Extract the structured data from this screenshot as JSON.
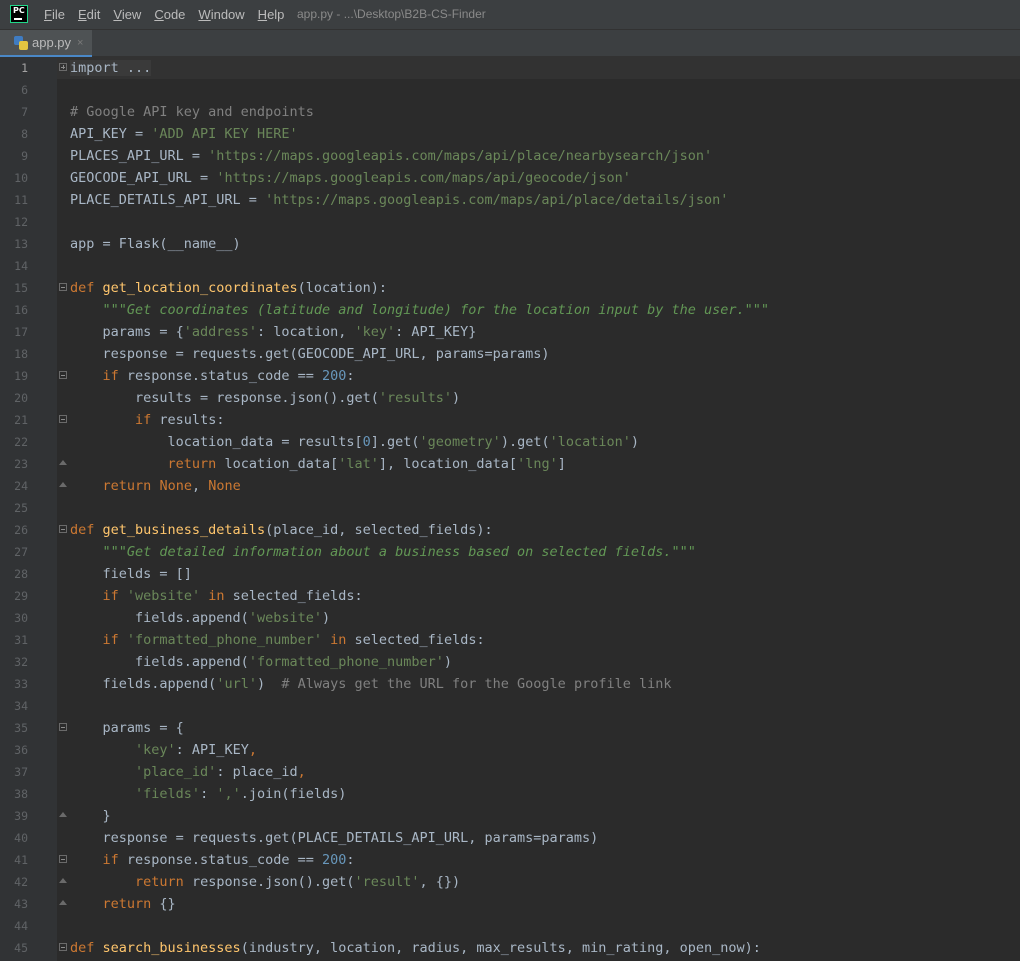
{
  "app": {
    "logo_text": "PC",
    "window_title": "app.py - ...\\Desktop\\B2B-CS-Finder"
  },
  "menu": [
    {
      "mnemonic": "F",
      "rest": "ile"
    },
    {
      "mnemonic": "E",
      "rest": "dit"
    },
    {
      "mnemonic": "V",
      "rest": "iew"
    },
    {
      "mnemonic": "C",
      "rest": "ode"
    },
    {
      "mnemonic": "W",
      "rest": "indow"
    },
    {
      "mnemonic": "H",
      "rest": "elp"
    }
  ],
  "tab": {
    "label": "app.py",
    "close_glyph": "×"
  },
  "editor": {
    "lines": [
      {
        "n": "1",
        "fold": "plus",
        "current": true,
        "tokens": [
          {
            "t": "import ...",
            "c": "folded-text"
          }
        ]
      },
      {
        "n": "6",
        "tokens": []
      },
      {
        "n": "7",
        "tokens": [
          {
            "t": "# Google API key and endpoints",
            "c": "cmt"
          }
        ]
      },
      {
        "n": "8",
        "tokens": [
          {
            "t": "API_KEY = "
          },
          {
            "t": "'ADD API KEY HERE'",
            "c": "str"
          }
        ]
      },
      {
        "n": "9",
        "tokens": [
          {
            "t": "PLACES_API_URL = "
          },
          {
            "t": "'https://maps.googleapis.com/maps/api/place/nearbysearch/json'",
            "c": "str"
          }
        ]
      },
      {
        "n": "10",
        "tokens": [
          {
            "t": "GEOCODE_API_URL = "
          },
          {
            "t": "'https://maps.googleapis.com/maps/api/geocode/json'",
            "c": "str"
          }
        ]
      },
      {
        "n": "11",
        "tokens": [
          {
            "t": "PLACE_DETAILS_API_URL = "
          },
          {
            "t": "'https://maps.googleapis.com/maps/api/place/details/json'",
            "c": "str"
          }
        ]
      },
      {
        "n": "12",
        "tokens": []
      },
      {
        "n": "13",
        "tokens": [
          {
            "t": "app = Flask(__name__)"
          }
        ]
      },
      {
        "n": "14",
        "tokens": []
      },
      {
        "n": "15",
        "fold": "minus",
        "tokens": [
          {
            "t": "def ",
            "c": "kw"
          },
          {
            "t": "get_location_coordinates",
            "c": "fn"
          },
          {
            "t": "(location):"
          }
        ]
      },
      {
        "n": "16",
        "tokens": [
          {
            "t": "    "
          },
          {
            "t": "\"\"\"Get coordinates (latitude and longitude) for the location input by the user.\"\"\"",
            "c": "doc"
          }
        ]
      },
      {
        "n": "17",
        "tokens": [
          {
            "t": "    params = {"
          },
          {
            "t": "'address'",
            "c": "str"
          },
          {
            "t": ": location, "
          },
          {
            "t": "'key'",
            "c": "str"
          },
          {
            "t": ": API_KEY}"
          }
        ]
      },
      {
        "n": "18",
        "tokens": [
          {
            "t": "    response = requests.get(GEOCODE_API_URL, params=params)"
          }
        ]
      },
      {
        "n": "19",
        "fold": "minus",
        "tokens": [
          {
            "t": "    "
          },
          {
            "t": "if",
            "c": "kw"
          },
          {
            "t": " response.status_code == "
          },
          {
            "t": "200",
            "c": "num"
          },
          {
            "t": ":"
          }
        ]
      },
      {
        "n": "20",
        "tokens": [
          {
            "t": "        results = response.json().get("
          },
          {
            "t": "'results'",
            "c": "str"
          },
          {
            "t": ")"
          }
        ]
      },
      {
        "n": "21",
        "fold": "minus",
        "tokens": [
          {
            "t": "        "
          },
          {
            "t": "if",
            "c": "kw"
          },
          {
            "t": " results:"
          }
        ]
      },
      {
        "n": "22",
        "tokens": [
          {
            "t": "            location_data = results["
          },
          {
            "t": "0",
            "c": "num"
          },
          {
            "t": "].get("
          },
          {
            "t": "'geometry'",
            "c": "str"
          },
          {
            "t": ").get("
          },
          {
            "t": "'location'",
            "c": "str"
          },
          {
            "t": ")"
          }
        ]
      },
      {
        "n": "23",
        "fold": "end",
        "tokens": [
          {
            "t": "            "
          },
          {
            "t": "return",
            "c": "kw"
          },
          {
            "t": " location_data["
          },
          {
            "t": "'lat'",
            "c": "str"
          },
          {
            "t": "], location_data["
          },
          {
            "t": "'lng'",
            "c": "str"
          },
          {
            "t": "]"
          }
        ]
      },
      {
        "n": "24",
        "fold": "end",
        "tokens": [
          {
            "t": "    "
          },
          {
            "t": "return",
            "c": "kw"
          },
          {
            "t": " "
          },
          {
            "t": "None",
            "c": "kw"
          },
          {
            "t": ", "
          },
          {
            "t": "None",
            "c": "kw"
          }
        ]
      },
      {
        "n": "25",
        "tokens": []
      },
      {
        "n": "26",
        "fold": "minus",
        "tokens": [
          {
            "t": "def ",
            "c": "kw"
          },
          {
            "t": "get_business_details",
            "c": "fn"
          },
          {
            "t": "(place_id, selected_fields):"
          }
        ]
      },
      {
        "n": "27",
        "tokens": [
          {
            "t": "    "
          },
          {
            "t": "\"\"\"Get detailed information about a business based on selected fields.\"\"\"",
            "c": "doc"
          }
        ]
      },
      {
        "n": "28",
        "tokens": [
          {
            "t": "    fields = []"
          }
        ]
      },
      {
        "n": "29",
        "tokens": [
          {
            "t": "    "
          },
          {
            "t": "if",
            "c": "kw"
          },
          {
            "t": " "
          },
          {
            "t": "'website'",
            "c": "str"
          },
          {
            "t": " "
          },
          {
            "t": "in",
            "c": "kw"
          },
          {
            "t": " selected_fields:"
          }
        ]
      },
      {
        "n": "30",
        "tokens": [
          {
            "t": "        fields.append("
          },
          {
            "t": "'website'",
            "c": "str"
          },
          {
            "t": ")"
          }
        ]
      },
      {
        "n": "31",
        "tokens": [
          {
            "t": "    "
          },
          {
            "t": "if",
            "c": "kw"
          },
          {
            "t": " "
          },
          {
            "t": "'formatted_phone_number'",
            "c": "str"
          },
          {
            "t": " "
          },
          {
            "t": "in",
            "c": "kw"
          },
          {
            "t": " selected_fields:"
          }
        ]
      },
      {
        "n": "32",
        "tokens": [
          {
            "t": "        fields.append("
          },
          {
            "t": "'formatted_phone_number'",
            "c": "str"
          },
          {
            "t": ")"
          }
        ]
      },
      {
        "n": "33",
        "tokens": [
          {
            "t": "    fields.append("
          },
          {
            "t": "'url'",
            "c": "str"
          },
          {
            "t": ")  "
          },
          {
            "t": "# Always get the URL for the Google profile link",
            "c": "cmt"
          }
        ]
      },
      {
        "n": "34",
        "tokens": []
      },
      {
        "n": "35",
        "fold": "minus",
        "tokens": [
          {
            "t": "    params = {"
          }
        ]
      },
      {
        "n": "36",
        "tokens": [
          {
            "t": "        "
          },
          {
            "t": "'key'",
            "c": "str"
          },
          {
            "t": ": API_KEY"
          },
          {
            "t": ",",
            "c": "kw"
          }
        ]
      },
      {
        "n": "37",
        "tokens": [
          {
            "t": "        "
          },
          {
            "t": "'place_id'",
            "c": "str"
          },
          {
            "t": ": place_id"
          },
          {
            "t": ",",
            "c": "kw"
          }
        ]
      },
      {
        "n": "38",
        "tokens": [
          {
            "t": "        "
          },
          {
            "t": "'fields'",
            "c": "str"
          },
          {
            "t": ": "
          },
          {
            "t": "','",
            "c": "str"
          },
          {
            "t": ".join(fields)"
          }
        ]
      },
      {
        "n": "39",
        "fold": "end",
        "tokens": [
          {
            "t": "    }"
          }
        ]
      },
      {
        "n": "40",
        "tokens": [
          {
            "t": "    response = requests.get(PLACE_DETAILS_API_URL, params=params)"
          }
        ]
      },
      {
        "n": "41",
        "fold": "minus",
        "tokens": [
          {
            "t": "    "
          },
          {
            "t": "if",
            "c": "kw"
          },
          {
            "t": " response.status_code == "
          },
          {
            "t": "200",
            "c": "num"
          },
          {
            "t": ":"
          }
        ]
      },
      {
        "n": "42",
        "fold": "end",
        "tokens": [
          {
            "t": "        "
          },
          {
            "t": "return",
            "c": "kw"
          },
          {
            "t": " response.json().get("
          },
          {
            "t": "'result'",
            "c": "str"
          },
          {
            "t": ", {})"
          }
        ]
      },
      {
        "n": "43",
        "fold": "end",
        "tokens": [
          {
            "t": "    "
          },
          {
            "t": "return",
            "c": "kw"
          },
          {
            "t": " {}"
          }
        ]
      },
      {
        "n": "44",
        "tokens": []
      },
      {
        "n": "45",
        "fold": "minus",
        "tokens": [
          {
            "t": "def ",
            "c": "kw"
          },
          {
            "t": "search_businesses",
            "c": "fn"
          },
          {
            "t": "(industry, location, radius, max_results, min_rating, open_now):"
          }
        ]
      }
    ]
  }
}
